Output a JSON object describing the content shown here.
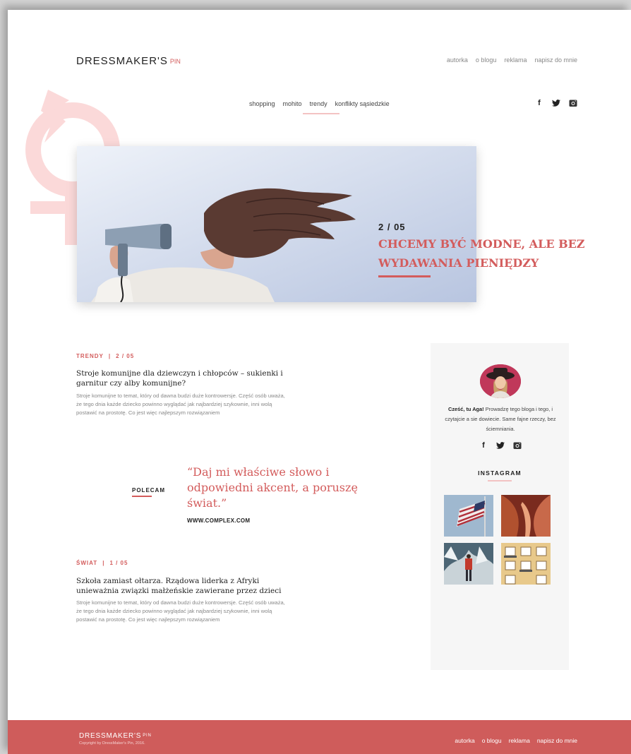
{
  "header": {
    "logo": "DRESSMAKER'S",
    "logo_suffix": "PIN",
    "nav": [
      "autorka",
      "o blogu",
      "reklama",
      "napisz do mnie"
    ],
    "categories": [
      "shopping",
      "mohito",
      "trendy",
      "konflikty sąsiedzkie"
    ],
    "active_category": "trendy",
    "social": [
      "facebook-icon",
      "twitter-icon",
      "instagram-icon"
    ]
  },
  "hero": {
    "counter": "2 / 05",
    "title": "CHCEMY BYĆ MODNE, ALE BEZ WYDAWANIA PIENIĘDZY"
  },
  "articles": [
    {
      "category": "TRENDY",
      "counter": "2 / 05",
      "title": "Stroje komunijne dla dziewczyn i chłopców – sukienki i garnitur czy alby komunijne?",
      "excerpt": "Stroje komunijne to temat, który od dawna budzi duże kontrowersje. Część osób uważa, że tego dnia każde dziecko powinno wyglądać jak najbardziej szykownie, inni wolą postawić na prostotę. Co jest więc najlepszym rozwiązaniem"
    },
    {
      "category": "ŚWIAT",
      "counter": "1 / 05",
      "title": "Szkoła zamiast ołtarza. Rządowa liderka z Afryki unieważnia związki małżeńskie zawierane przez dzieci",
      "excerpt": "Stroje komunijne to temat, który od dawna budzi duże kontrowersje. Część osób uważa, że tego dnia każde dziecko powinno wyglądać jak najbardziej szykownie, inni wolą postawić na prostotę. Co jest więc najlepszym rozwiązaniem"
    }
  ],
  "recommend": {
    "label": "POLECAM",
    "quote": "“Daj mi właściwe słowo i odpowiedni akcent, a poruszę świat.”",
    "source": "WWW.COMPLEX.COM"
  },
  "sidebar": {
    "greeting": "Cześć, tu Aga!",
    "bio": " Prowadzę tego bloga i tego, i czytajcie a sie dowiecie. Same fajne rzeczy, bez ściemniania.",
    "instagram_title": "INSTAGRAM"
  },
  "footer": {
    "logo": "DRESSMAKER'S",
    "logo_suffix": "PIN",
    "copyright": "Copyright by DressMaker's Pin, 2016.",
    "nav": [
      "autorka",
      "o blogu",
      "reklama",
      "napisz do mnie"
    ]
  },
  "colors": {
    "accent": "#d35c5c",
    "footer": "#cf5c5b",
    "accent_light": "#f3c3c3",
    "sidebar_bg": "#f6f6f6"
  }
}
